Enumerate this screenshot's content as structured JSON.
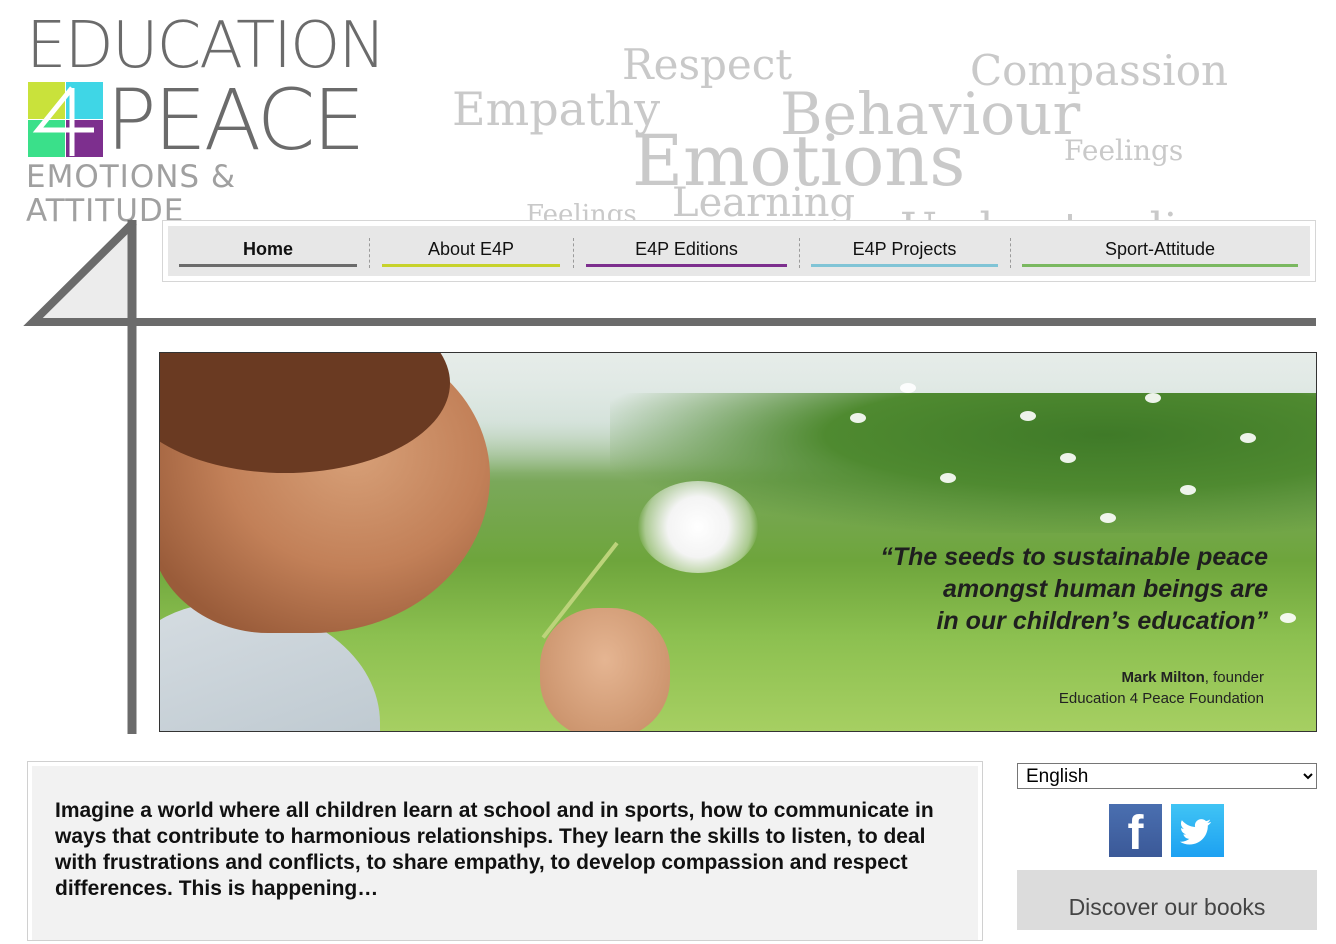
{
  "logo": {
    "line1": "EDUCATION",
    "line2": "PEACE",
    "line3": "EMOTIONS & ATTITUDE",
    "colors": [
      "#c9e23b",
      "#3fd6e6",
      "#3ae08a",
      "#7d2f8e"
    ]
  },
  "word_cloud": [
    "Respect",
    "Compassion",
    "Empathy",
    "Behaviour",
    "Emotions",
    "Feelings",
    "Learning",
    "Feelings",
    "Understanding"
  ],
  "nav": {
    "items": [
      {
        "label": "Home",
        "color": "#6b6b6b"
      },
      {
        "label": "About E4P",
        "color": "#c7d22b"
      },
      {
        "label": "E4P Editions",
        "color": "#7d2f8e"
      },
      {
        "label": "E4P Projects",
        "color": "#80c4d6"
      },
      {
        "label": "Sport-Attitude",
        "color": "#7ab860"
      }
    ]
  },
  "hero": {
    "quote_line1": "“The seeds to sustainable peace",
    "quote_line2": "amongst human beings are",
    "quote_line3": "in our children’s education”",
    "author_name": "Mark Milton",
    "author_role": ", founder",
    "author_org": "Education 4 Peace Foundation"
  },
  "content": {
    "intro": "Imagine a world where all children learn at school and in sports, how to communicate in ways that contribute to harmonious relationships. They learn the skills to listen, to deal with frustrations and conflicts, to share empathy, to develop compassion and respect differences. This is happening…"
  },
  "sidebar": {
    "language": "English",
    "facebook_icon": "facebook-icon",
    "twitter_icon": "twitter-icon",
    "books_label": "Discover our books"
  }
}
